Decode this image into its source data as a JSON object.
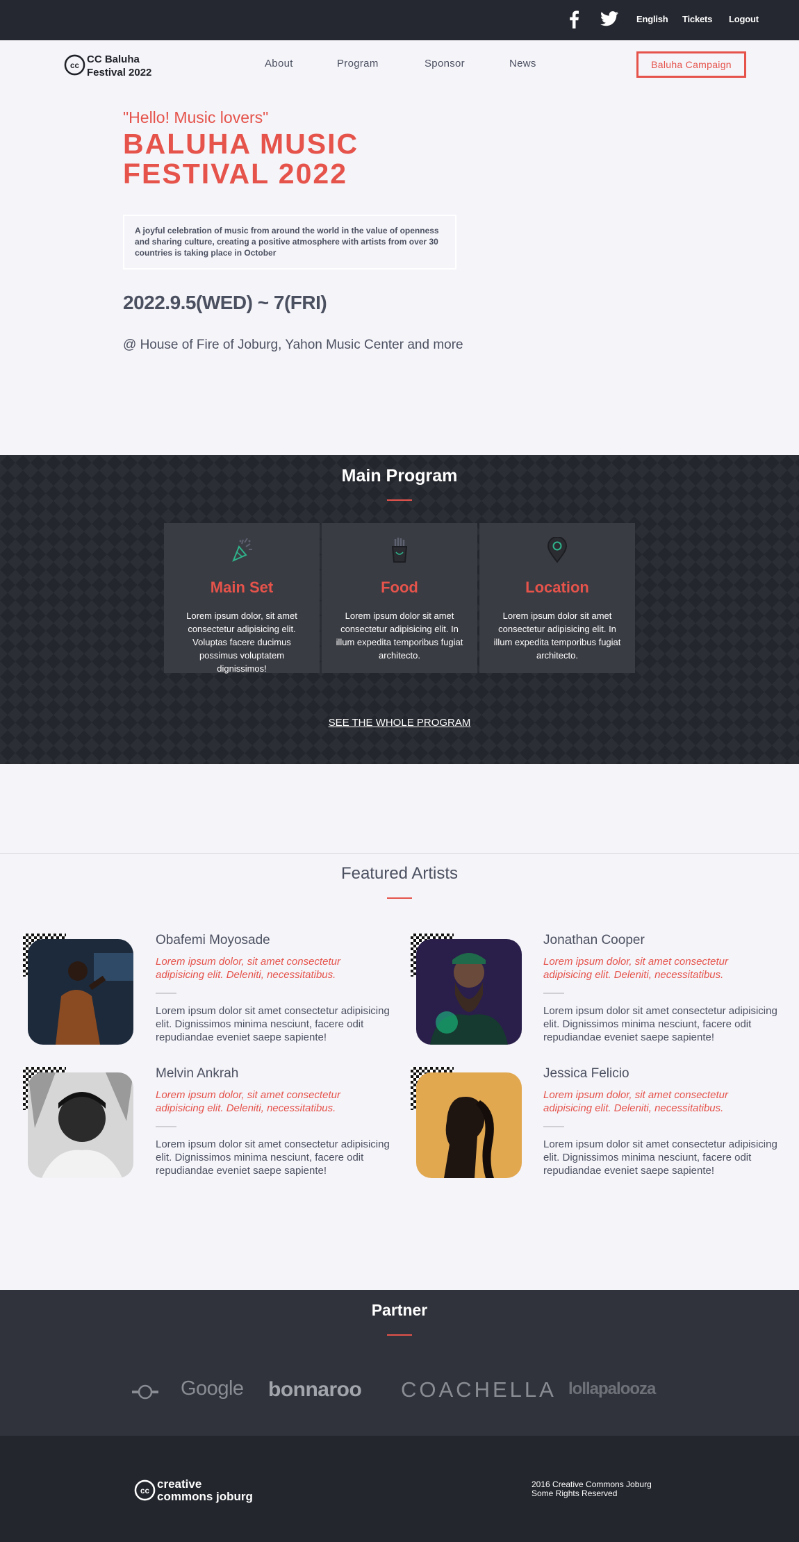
{
  "topbar": {
    "language": "English",
    "tickets": "Tickets",
    "logout": "Logout"
  },
  "nav": {
    "brand_line1": "CC Baluha",
    "brand_line2": "Festival 2022",
    "links": [
      "About",
      "Program",
      "Sponsor",
      "News"
    ],
    "campaign": "Baluha Campaign"
  },
  "hero": {
    "hello": "\"Hello! Music lovers\"",
    "title_line1": "BALUHA MUSIC",
    "title_line2": "FESTIVAL 2022",
    "description": "A joyful celebration of music from around the world in the value of openness and sharing culture, creating a positive atmosphere with artists from over 30 countries is taking place in October",
    "date": "2022.9.5(WED) ~ 7(FRI)",
    "venue": "@ House of Fire of Joburg, Yahon Music Center and more"
  },
  "program": {
    "title": "Main Program",
    "cards": [
      {
        "title": "Main Set",
        "icon": "party-popper-icon",
        "text": "Lorem ipsum dolor, sit amet consectetur adipisicing elit. Voluptas facere ducimus possimus voluptatem dignissimos!"
      },
      {
        "title": "Food",
        "icon": "fries-icon",
        "text": "Lorem ipsum dolor sit amet consectetur adipisicing elit. In illum expedita temporibus fugiat architecto."
      },
      {
        "title": "Location",
        "icon": "map-pin-icon",
        "text": "Lorem ipsum dolor sit amet consectetur adipisicing elit. In illum expedita temporibus fugiat architecto."
      }
    ],
    "see_all": "SEE THE WHOLE PROGRAM"
  },
  "artists": {
    "title": "Featured Artists",
    "items": [
      {
        "name": "Obafemi Moyosade",
        "quote": "Lorem ipsum dolor, sit amet consectetur adipisicing elit. Deleniti, necessitatibus.",
        "bio": "Lorem ipsum dolor sit amet consectetur adipisicing elit. Dignissimos minima nesciunt, facere odit repudiandae eveniet saepe sapiente!"
      },
      {
        "name": "Jonathan Cooper",
        "quote": "Lorem ipsum dolor, sit amet consectetur adipisicing elit. Deleniti, necessitatibus.",
        "bio": "Lorem ipsum dolor sit amet consectetur adipisicing elit. Dignissimos minima nesciunt, facere odit repudiandae eveniet saepe sapiente!"
      },
      {
        "name": "Melvin Ankrah",
        "quote": "Lorem ipsum dolor, sit amet consectetur adipisicing elit. Deleniti, necessitatibus.",
        "bio": "Lorem ipsum dolor sit amet consectetur adipisicing elit. Dignissimos minima nesciunt, facere odit repudiandae eveniet saepe sapiente!"
      },
      {
        "name": "Jessica Felicio",
        "quote": "Lorem ipsum dolor, sit amet consectetur adipisicing elit. Deleniti, necessitatibus.",
        "bio": "Lorem ipsum dolor sit amet consectetur adipisicing elit. Dignissimos minima nesciunt, facere odit repudiandae eveniet saepe sapiente!"
      }
    ]
  },
  "partners": {
    "title": "Partner",
    "logos": [
      "Google",
      "bonnaroo",
      "COACHELLA",
      "lollapalooza"
    ]
  },
  "footer": {
    "logo_line1": "creative",
    "logo_line2": "commons joburg",
    "copyright_line1": "2016 Creative Commons Joburg",
    "copyright_line2": "Some Rights Reserved"
  },
  "colors": {
    "accent": "#e5534b",
    "dark": "#23262d",
    "text": "#4b5060",
    "background": "#f5f4f9"
  }
}
